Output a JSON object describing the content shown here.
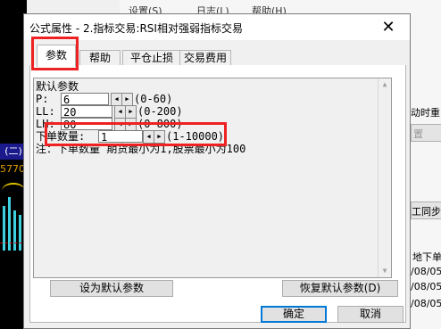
{
  "background": {
    "menu": [
      "设置(S)",
      "日志(L)",
      "帮助(H)"
    ],
    "chart_label": "(二)",
    "chart_number": "5770",
    "right_snippets": [
      "动时重",
      "置",
      "工同步",
      "地下单",
      "/08/05",
      "/08/05",
      "/08/05"
    ]
  },
  "dialog": {
    "title": "公式属性 - 2.指标交易:RSI相对强弱指标交易",
    "close_glyph": "✕",
    "tabs": [
      "参数",
      "帮助",
      "平仓止损",
      "交易费用"
    ],
    "active_tab": "参数",
    "section_title": "默认参数",
    "params": [
      {
        "label": "P:",
        "value": "6",
        "range": "(0-60)"
      },
      {
        "label": "LL:",
        "value": "20",
        "range": "(0-200)"
      },
      {
        "label": "LH:",
        "value": "80",
        "range": "(0-800)"
      }
    ],
    "order_qty": {
      "label": "下单数量:",
      "value": "1",
      "range": "(1-10000)"
    },
    "note": "注：下单数量 期货最小为1,股票最小为100",
    "buttons": {
      "set_default": "设为默认参数",
      "restore_default": "恢复默认参数(D)",
      "ok": "确定",
      "cancel": "取消"
    },
    "spin_left": "◀",
    "spin_right": "▶",
    "scroll_up": "▲",
    "scroll_down": "▼"
  }
}
